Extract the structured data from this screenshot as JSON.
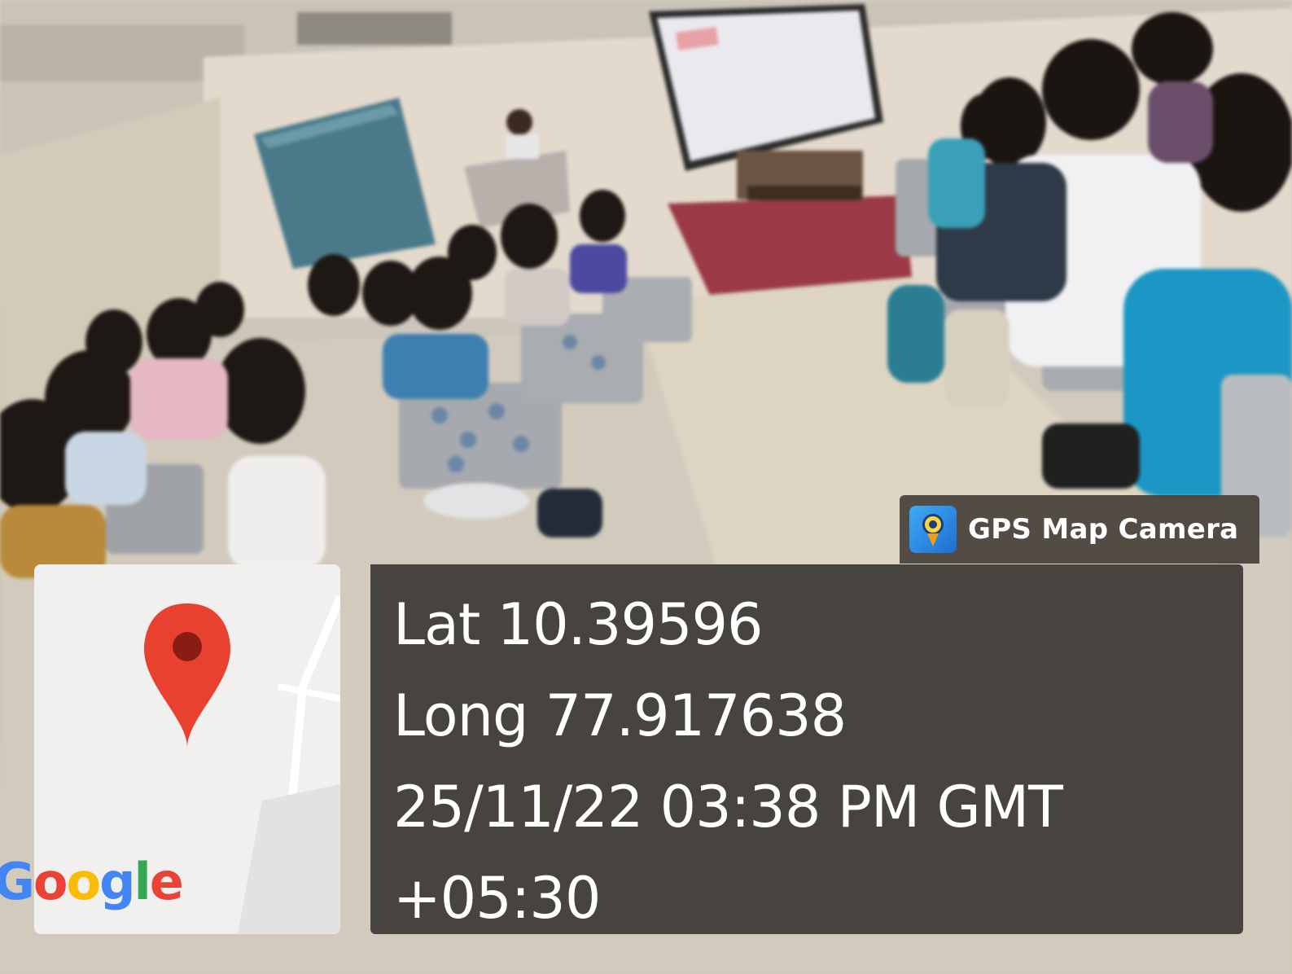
{
  "badge": {
    "app_name": "GPS Map Camera",
    "logo_icon": "gps-map-camera-icon"
  },
  "map": {
    "provider_label": "Google",
    "marker_icon": "map-pin-icon",
    "pin_color": "#e8412f"
  },
  "location": {
    "latitude_line": "Lat 10.39596",
    "longitude_line": "Long 77.917638",
    "datetime_line": "25/11/22 03:38 PM GMT",
    "timezone_line": "+05:30"
  },
  "colors": {
    "panel": "#3e3a36",
    "google_blue": "#4285f4",
    "google_red": "#ea4335",
    "google_yellow": "#fbbc05",
    "google_green": "#34a853"
  }
}
